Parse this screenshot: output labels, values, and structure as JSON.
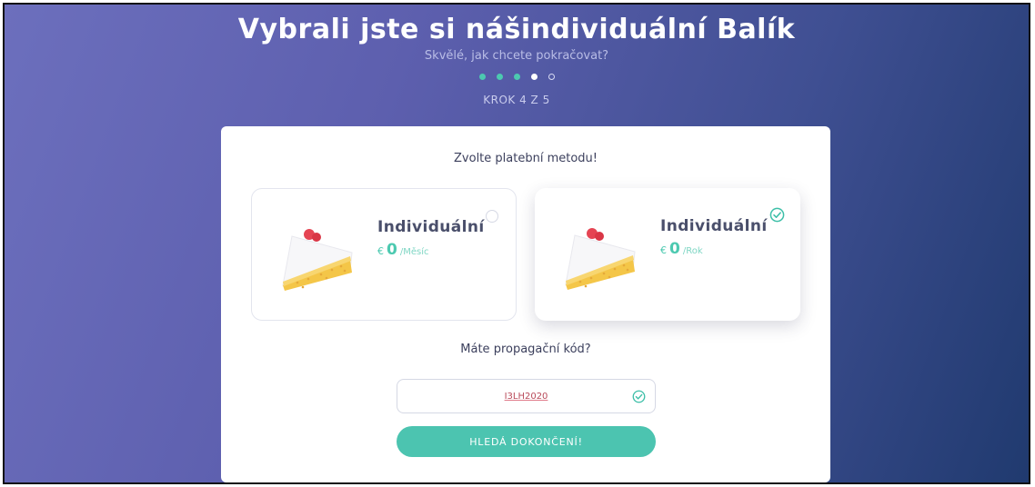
{
  "header": {
    "title": "Vybrali jste si nášindividuální Balík",
    "subtitle": "Skvělé, jak chcete pokračovat?",
    "step_label": "KROK 4 Z 5",
    "steps_total": 5,
    "steps_current": 4
  },
  "card": {
    "heading": "Zvolte platební metodu!",
    "plans": [
      {
        "name": "Individuální",
        "currency": "€",
        "amount": "0",
        "period": "/Měsíc",
        "selected": false,
        "icon": "cake-slice-icon"
      },
      {
        "name": "Individuální",
        "currency": "€",
        "amount": "0",
        "period": "/Rok",
        "selected": true,
        "icon": "cake-slice-icon"
      }
    ],
    "promo": {
      "label": "Máte propagační kód?",
      "value": "I3LH2020",
      "valid": true
    },
    "submit_label": "HLEDÁ DOKONČENÍ!"
  },
  "colors": {
    "accent": "#4cc4b0",
    "text": "#3b3f5c"
  }
}
